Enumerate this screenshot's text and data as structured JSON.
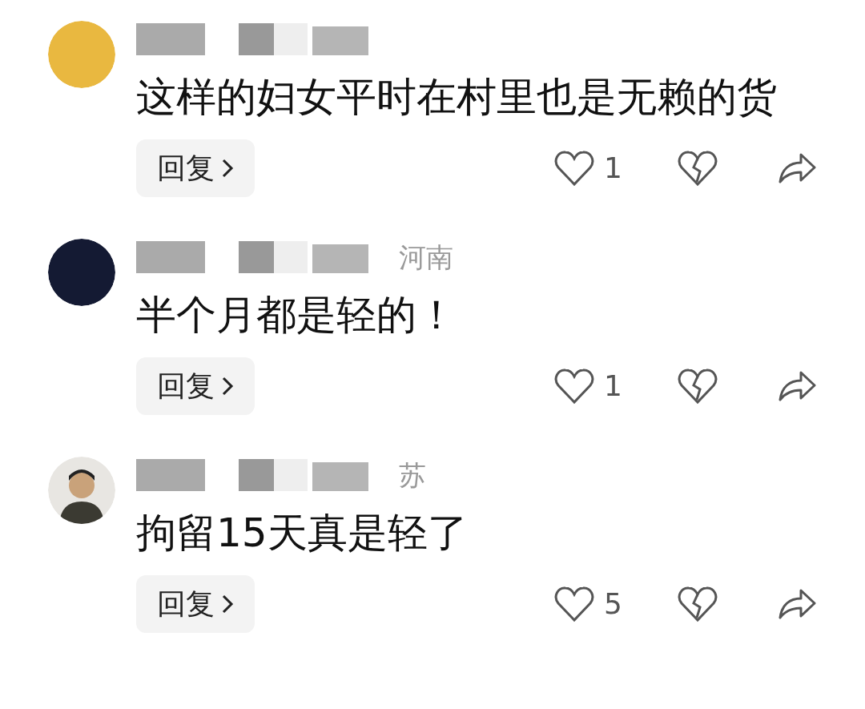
{
  "comments": [
    {
      "avatar": {
        "kind": "plain",
        "color": "#e9b840"
      },
      "text": "这样的妇女平时在村里也是无赖的货",
      "reply": "回复",
      "likes": "1"
    },
    {
      "avatar": {
        "kind": "plain",
        "color": "#141a33"
      },
      "location": "河南",
      "text": "半个月都是轻的！",
      "reply": "回复",
      "likes": "1"
    },
    {
      "avatar": {
        "kind": "figure",
        "color": "#e8e6e2"
      },
      "location": "苏",
      "text": "拘留15天真是轻了",
      "reply": "回复",
      "likes": "5"
    }
  ]
}
